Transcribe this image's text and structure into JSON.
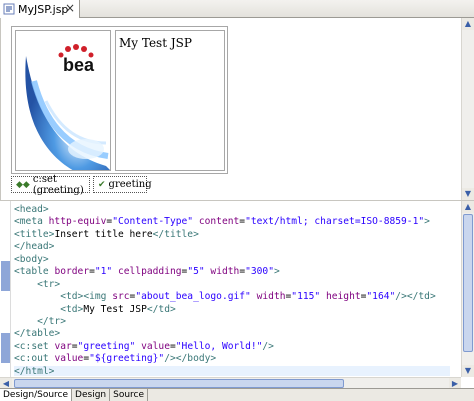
{
  "editor_tab": {
    "icon": "jsp-file-icon",
    "title": "MyJSP.jsp",
    "close": "×"
  },
  "design": {
    "logo_text": "bea",
    "cell_text": "My Test JSP",
    "chips": [
      {
        "label": "c:set (greeting)",
        "icon": "jstl-tag-icon"
      },
      {
        "label": "greeting",
        "icon": "output-tag-icon"
      }
    ]
  },
  "source": {
    "lines": [
      [
        {
          "c": "tg",
          "t": "<head>"
        }
      ],
      [
        {
          "c": "tg",
          "t": "<meta "
        },
        {
          "c": "at",
          "t": "http-equiv"
        },
        {
          "c": "tx",
          "t": "="
        },
        {
          "c": "vl",
          "t": "\"Content-Type\""
        },
        {
          "c": "tx",
          "t": " "
        },
        {
          "c": "at",
          "t": "content"
        },
        {
          "c": "tx",
          "t": "="
        },
        {
          "c": "vl",
          "t": "\"text/html; charset=ISO-8859-1\""
        },
        {
          "c": "tg",
          "t": ">"
        }
      ],
      [
        {
          "c": "tg",
          "t": "<title>"
        },
        {
          "c": "tx",
          "t": "Insert title here"
        },
        {
          "c": "tg",
          "t": "</title>"
        }
      ],
      [
        {
          "c": "tg",
          "t": "</head>"
        }
      ],
      [
        {
          "c": "tg",
          "t": "<body>"
        }
      ],
      [
        {
          "c": "tg",
          "t": "<table "
        },
        {
          "c": "at",
          "t": "border"
        },
        {
          "c": "tx",
          "t": "="
        },
        {
          "c": "vl",
          "t": "\"1\""
        },
        {
          "c": "tx",
          "t": " "
        },
        {
          "c": "at",
          "t": "cellpadding"
        },
        {
          "c": "tx",
          "t": "="
        },
        {
          "c": "vl",
          "t": "\"5\""
        },
        {
          "c": "tx",
          "t": " "
        },
        {
          "c": "at",
          "t": "width"
        },
        {
          "c": "tx",
          "t": "="
        },
        {
          "c": "vl",
          "t": "\"300\""
        },
        {
          "c": "tg",
          "t": ">"
        }
      ],
      [
        {
          "c": "tx",
          "t": "    "
        },
        {
          "c": "tg",
          "t": "<tr>"
        }
      ],
      [
        {
          "c": "tx",
          "t": "        "
        },
        {
          "c": "tg",
          "t": "<td><img "
        },
        {
          "c": "at",
          "t": "src"
        },
        {
          "c": "tx",
          "t": "="
        },
        {
          "c": "vl",
          "t": "\"about_bea_logo.gif\""
        },
        {
          "c": "tx",
          "t": " "
        },
        {
          "c": "at",
          "t": "width"
        },
        {
          "c": "tx",
          "t": "="
        },
        {
          "c": "vl",
          "t": "\"115\""
        },
        {
          "c": "tx",
          "t": " "
        },
        {
          "c": "at",
          "t": "height"
        },
        {
          "c": "tx",
          "t": "="
        },
        {
          "c": "vl",
          "t": "\"164\""
        },
        {
          "c": "tg",
          "t": "/></td>"
        }
      ],
      [
        {
          "c": "tx",
          "t": "        "
        },
        {
          "c": "tg",
          "t": "<td>"
        },
        {
          "c": "tx",
          "t": "My Test JSP"
        },
        {
          "c": "tg",
          "t": "</td>"
        }
      ],
      [
        {
          "c": "tx",
          "t": "    "
        },
        {
          "c": "tg",
          "t": "</tr>"
        }
      ],
      [
        {
          "c": "tg",
          "t": "</table>"
        }
      ],
      [
        {
          "c": "tg",
          "t": "<c:set "
        },
        {
          "c": "at",
          "t": "var"
        },
        {
          "c": "tx",
          "t": "="
        },
        {
          "c": "vl",
          "t": "\"greeting\""
        },
        {
          "c": "tx",
          "t": " "
        },
        {
          "c": "at",
          "t": "value"
        },
        {
          "c": "tx",
          "t": "="
        },
        {
          "c": "vl",
          "t": "\"Hello, World!\""
        },
        {
          "c": "tg",
          "t": "/>"
        }
      ],
      [
        {
          "c": "tg",
          "t": "<c:out "
        },
        {
          "c": "at",
          "t": "value"
        },
        {
          "c": "tx",
          "t": "="
        },
        {
          "c": "vl",
          "t": "\"${greeting}\""
        },
        {
          "c": "tg",
          "t": "/></body>"
        }
      ],
      [
        {
          "c": "tg",
          "t": "</html>"
        }
      ]
    ],
    "current_line": 13
  },
  "bottom_tabs": [
    {
      "label": "Design/Source",
      "active": true
    },
    {
      "label": "Design",
      "active": false
    },
    {
      "label": "Source",
      "active": false
    }
  ],
  "colors": {
    "tag": "#3a7777",
    "attribute": "#7f007f",
    "value": "#2a00ff",
    "scroll_thumb": "#c9d6ee"
  }
}
